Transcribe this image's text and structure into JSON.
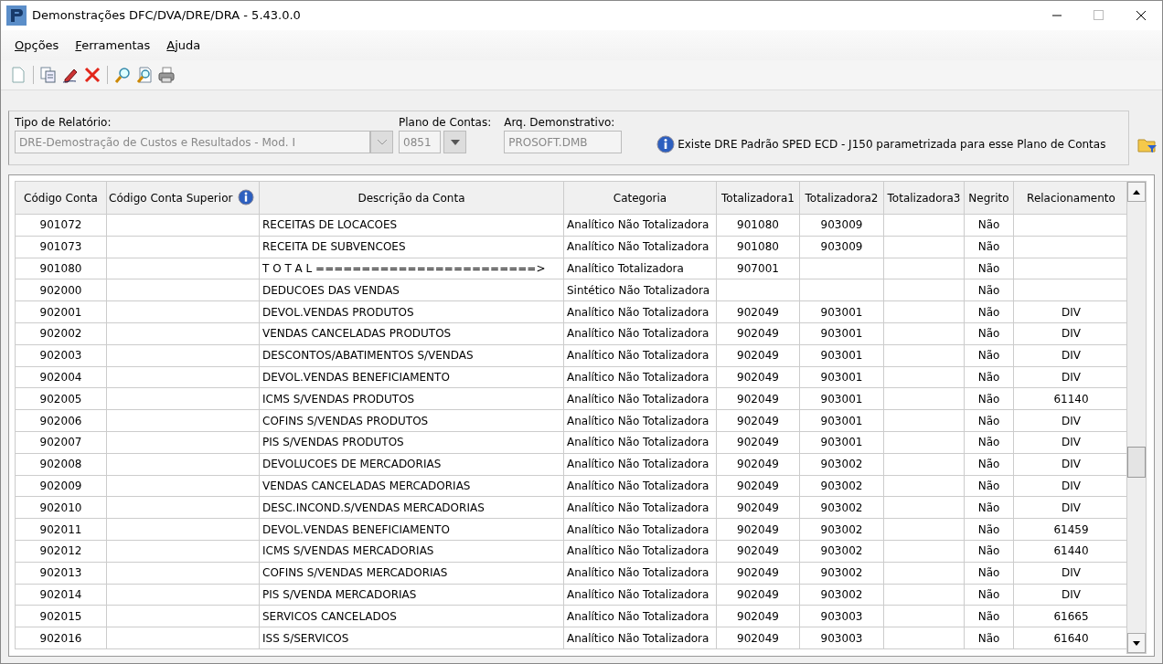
{
  "window": {
    "title": "Demonstrações DFC/DVA/DRE/DRA - 5.43.0.0"
  },
  "menu": [
    "Opções",
    "Ferramentas",
    "Ajuda"
  ],
  "filters": {
    "report_type": {
      "label": "Tipo de Relatório:",
      "value": "DRE-Demostração de Custos e Resultados - Mod. I",
      "disabled": true
    },
    "chart_of_accounts": {
      "label": "Plano de Contas:",
      "value": "0851",
      "disabled": true
    },
    "statement_file": {
      "label": "Arq. Demonstrativo:",
      "value": "PROSOFT.DMB",
      "disabled": true
    },
    "info": "Existe DRE Padrão SPED ECD - J150 parametrizada para esse Plano de Contas"
  },
  "table": {
    "columns": [
      {
        "label": "Código Conta",
        "info": false
      },
      {
        "label": "Código Conta Superior",
        "info": true
      },
      {
        "label": "Descrição da Conta",
        "info": false
      },
      {
        "label": "Categoria",
        "info": false
      },
      {
        "label": "Totalizadora1",
        "info": false
      },
      {
        "label": "Totalizadora2",
        "info": false
      },
      {
        "label": "Totalizadora3",
        "info": false
      },
      {
        "label": "Negrito",
        "info": false
      },
      {
        "label": "Relacionamento",
        "info": false
      }
    ],
    "rows": [
      [
        "901072",
        "",
        "RECEITAS DE LOCACOES",
        "Analítico Não Totalizadora",
        "901080",
        "903009",
        "",
        "Não",
        ""
      ],
      [
        "901073",
        "",
        "RECEITA DE SUBVENCOES",
        "Analítico Não Totalizadora",
        "901080",
        "903009",
        "",
        "Não",
        ""
      ],
      [
        "901080",
        "",
        "T O T A L ========================>",
        "Analítico Totalizadora",
        "907001",
        "",
        "",
        "Não",
        ""
      ],
      [
        "902000",
        "",
        "DEDUCOES DAS VENDAS",
        "Sintético Não Totalizadora",
        "",
        "",
        "",
        "Não",
        ""
      ],
      [
        "902001",
        "",
        "DEVOL.VENDAS PRODUTOS",
        "Analítico Não Totalizadora",
        "902049",
        "903001",
        "",
        "Não",
        "DIV"
      ],
      [
        "902002",
        "",
        "VENDAS CANCELADAS PRODUTOS",
        "Analítico Não Totalizadora",
        "902049",
        "903001",
        "",
        "Não",
        "DIV"
      ],
      [
        "902003",
        "",
        "DESCONTOS/ABATIMENTOS S/VENDAS",
        "Analítico Não Totalizadora",
        "902049",
        "903001",
        "",
        "Não",
        "DIV"
      ],
      [
        "902004",
        "",
        "DEVOL.VENDAS BENEFICIAMENTO",
        "Analítico Não Totalizadora",
        "902049",
        "903001",
        "",
        "Não",
        "DIV"
      ],
      [
        "902005",
        "",
        "ICMS S/VENDAS PRODUTOS",
        "Analítico Não Totalizadora",
        "902049",
        "903001",
        "",
        "Não",
        "61140"
      ],
      [
        "902006",
        "",
        "COFINS S/VENDAS PRODUTOS",
        "Analítico Não Totalizadora",
        "902049",
        "903001",
        "",
        "Não",
        "DIV"
      ],
      [
        "902007",
        "",
        "PIS S/VENDAS PRODUTOS",
        "Analítico Não Totalizadora",
        "902049",
        "903001",
        "",
        "Não",
        "DIV"
      ],
      [
        "902008",
        "",
        "DEVOLUCOES DE MERCADORIAS",
        "Analítico Não Totalizadora",
        "902049",
        "903002",
        "",
        "Não",
        "DIV"
      ],
      [
        "902009",
        "",
        "VENDAS CANCELADAS MERCADORIAS",
        "Analítico Não Totalizadora",
        "902049",
        "903002",
        "",
        "Não",
        "DIV"
      ],
      [
        "902010",
        "",
        "DESC.INCOND.S/VENDAS MERCADORIAS",
        "Analítico Não Totalizadora",
        "902049",
        "903002",
        "",
        "Não",
        "DIV"
      ],
      [
        "902011",
        "",
        "DEVOL.VENDAS BENEFICIAMENTO",
        "Analítico Não Totalizadora",
        "902049",
        "903002",
        "",
        "Não",
        "61459"
      ],
      [
        "902012",
        "",
        "ICMS S/VENDAS MERCADORIAS",
        "Analítico Não Totalizadora",
        "902049",
        "903002",
        "",
        "Não",
        "61440"
      ],
      [
        "902013",
        "",
        "COFINS S/VENDAS MERCADORIAS",
        "Analítico Não Totalizadora",
        "902049",
        "903002",
        "",
        "Não",
        "DIV"
      ],
      [
        "902014",
        "",
        "PIS S/VENDA MERCADORIAS",
        "Analítico Não Totalizadora",
        "902049",
        "903002",
        "",
        "Não",
        "DIV"
      ],
      [
        "902015",
        "",
        "SERVICOS CANCELADOS",
        "Analítico Não Totalizadora",
        "902049",
        "903003",
        "",
        "Não",
        "61665"
      ],
      [
        "902016",
        "",
        "ISS S/SERVICOS",
        "Analítico Não Totalizadora",
        "902049",
        "903003",
        "",
        "Não",
        "61640"
      ]
    ]
  }
}
